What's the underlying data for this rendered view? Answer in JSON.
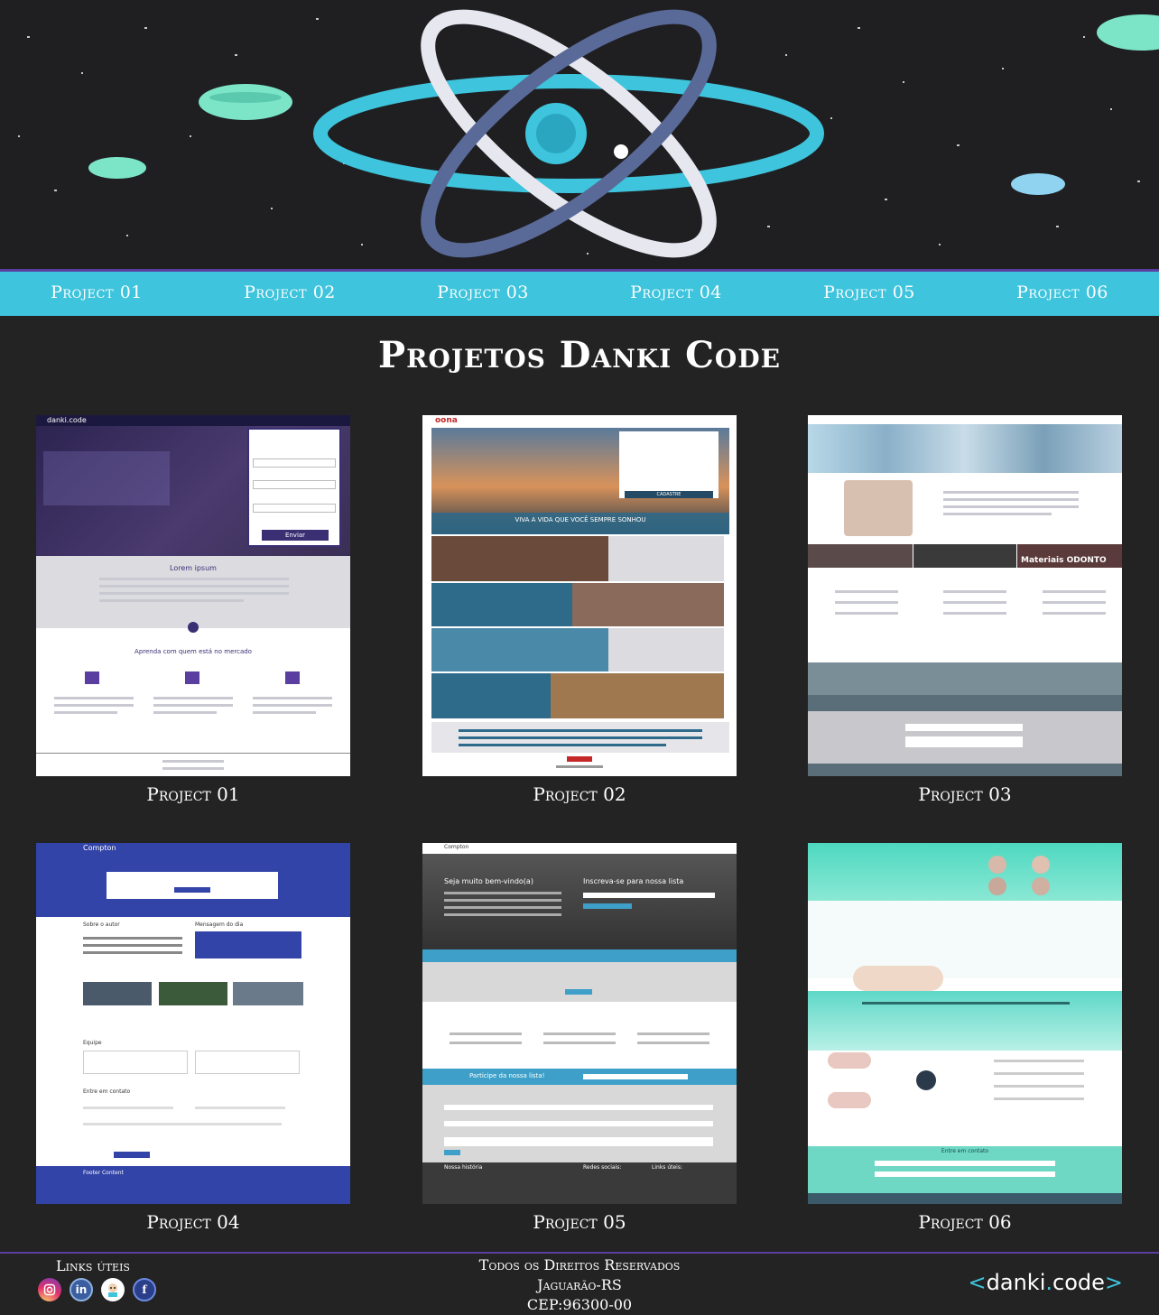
{
  "nav": {
    "items": [
      {
        "label": "Project 01"
      },
      {
        "label": "Project 02"
      },
      {
        "label": "Project 03"
      },
      {
        "label": "Project 04"
      },
      {
        "label": "Project 05"
      },
      {
        "label": "Project 06"
      }
    ]
  },
  "page_title": "Projetos Danki Code",
  "projects": [
    {
      "label": "Project 01",
      "thumb": {
        "brand": "danki.code",
        "heading": "Lorem ipsum",
        "subheading": "Aprenda com quem está no mercado",
        "button": "Enviar"
      }
    },
    {
      "label": "Project 02",
      "thumb": {
        "brand": "oona",
        "tagline": "VIVA A VIDA QUE VOCÊ SEMPRE SONHOU",
        "button": "CADASTRE"
      }
    },
    {
      "label": "Project 03",
      "thumb": {
        "badge": "Materiais ODONTO"
      }
    },
    {
      "label": "Project 04",
      "thumb": {
        "brand": "Compton",
        "section1": "Sobre o autor",
        "section2": "Mensagem do dia",
        "section3": "Equipe",
        "section4": "Entre em contato",
        "footer_title": "Footer Content"
      }
    },
    {
      "label": "Project 05",
      "thumb": {
        "brand": "Compton",
        "welcome": "Seja muito bem-vindo(a)",
        "subscribe": "Inscreva-se para nossa lista",
        "cta": "Participe da nossa lista!",
        "history": "Nossa história",
        "social": "Redes sociais:",
        "links": "Links úteis:"
      }
    },
    {
      "label": "Project 06",
      "thumb": {
        "cta": "Entre em contato"
      }
    }
  ],
  "footer": {
    "links_title": "Links úteis",
    "social_icons": [
      "instagram-icon",
      "linkedin-icon",
      "github-icon",
      "facebook-icon"
    ],
    "rights": "Todos os Direitos Reservados",
    "city": "Jaguarão-RS",
    "cep": "CEP:96300-00",
    "brand_left": "<",
    "brand_name": "danki",
    "brand_dot": ".",
    "brand_suffix": "code",
    "brand_right": ">"
  },
  "colors": {
    "nav_bg": "#3ec4dc",
    "accent_purple": "#5b3fa0",
    "page_bg": "#232323"
  }
}
